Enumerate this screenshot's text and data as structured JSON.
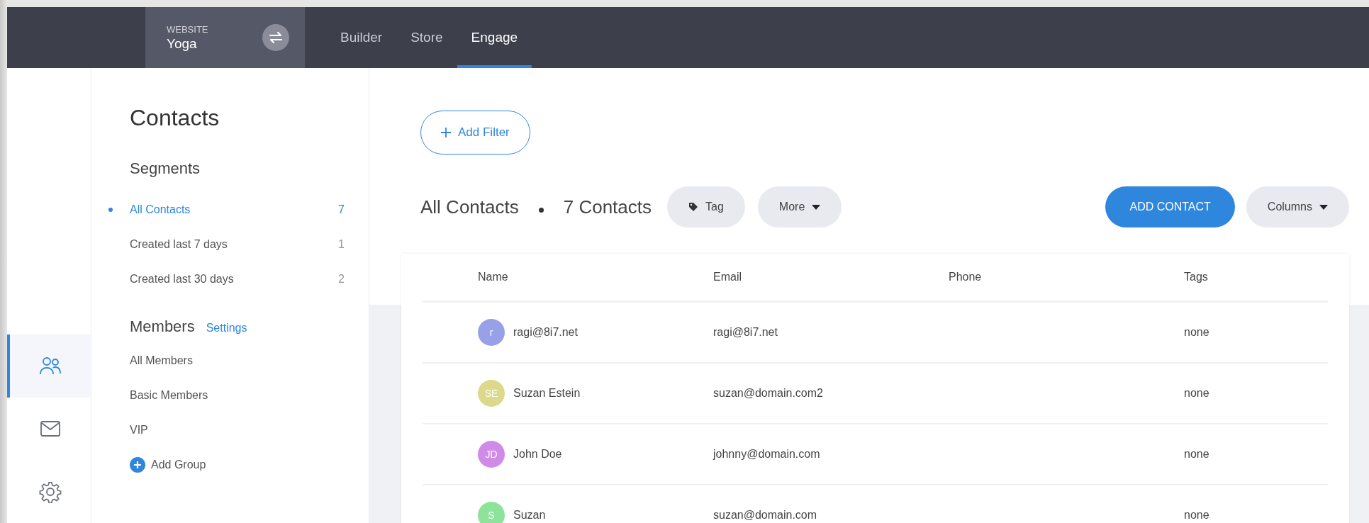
{
  "topbar": {
    "site_label": "WEBSITE",
    "site_name": "Yoga",
    "tabs": [
      {
        "label": "Builder",
        "selected": false
      },
      {
        "label": "Store",
        "selected": false
      },
      {
        "label": "Engage",
        "selected": true
      }
    ]
  },
  "rail": [
    {
      "kind": "contacts",
      "selected": true
    },
    {
      "kind": "mail",
      "selected": false
    },
    {
      "kind": "settings",
      "selected": false
    }
  ],
  "sidebar": {
    "title": "Contacts",
    "segments_heading": "Segments",
    "segments": [
      {
        "label": "All Contacts",
        "count": "7",
        "selected": true
      },
      {
        "label": "Created last 7 days",
        "count": "1",
        "selected": false
      },
      {
        "label": "Created last 30 days",
        "count": "2",
        "selected": false
      }
    ],
    "members_heading": "Members",
    "members_settings": "Settings",
    "members": [
      {
        "label": "All Members"
      },
      {
        "label": "Basic Members"
      },
      {
        "label": "VIP"
      }
    ],
    "add_group": "Add Group"
  },
  "toolbar": {
    "add_filter": "Add Filter",
    "list_name": "All Contacts",
    "contact_count": "7 Contacts",
    "tag_button": "Tag",
    "more_button": "More",
    "add_contact_button": "ADD CONTACT",
    "columns_button": "Columns"
  },
  "table": {
    "columns": [
      "Name",
      "Email",
      "Phone",
      "Tags"
    ],
    "rows": [
      {
        "initials": "r",
        "color": "#98a0e8",
        "name": "ragi@8i7.net",
        "email": "ragi@8i7.net",
        "tags": "none"
      },
      {
        "initials": "SE",
        "color": "#dcd98a",
        "name": "Suzan Estein",
        "email": "suzan@domain.com2",
        "tags": "none"
      },
      {
        "initials": "JD",
        "color": "#d08be8",
        "name": "John Doe",
        "email": "johnny@domain.com",
        "tags": "none"
      },
      {
        "initials": "S",
        "color": "#8ee39a",
        "name": "Suzan",
        "email": "suzan@domain.com",
        "tags": "none"
      }
    ]
  }
}
